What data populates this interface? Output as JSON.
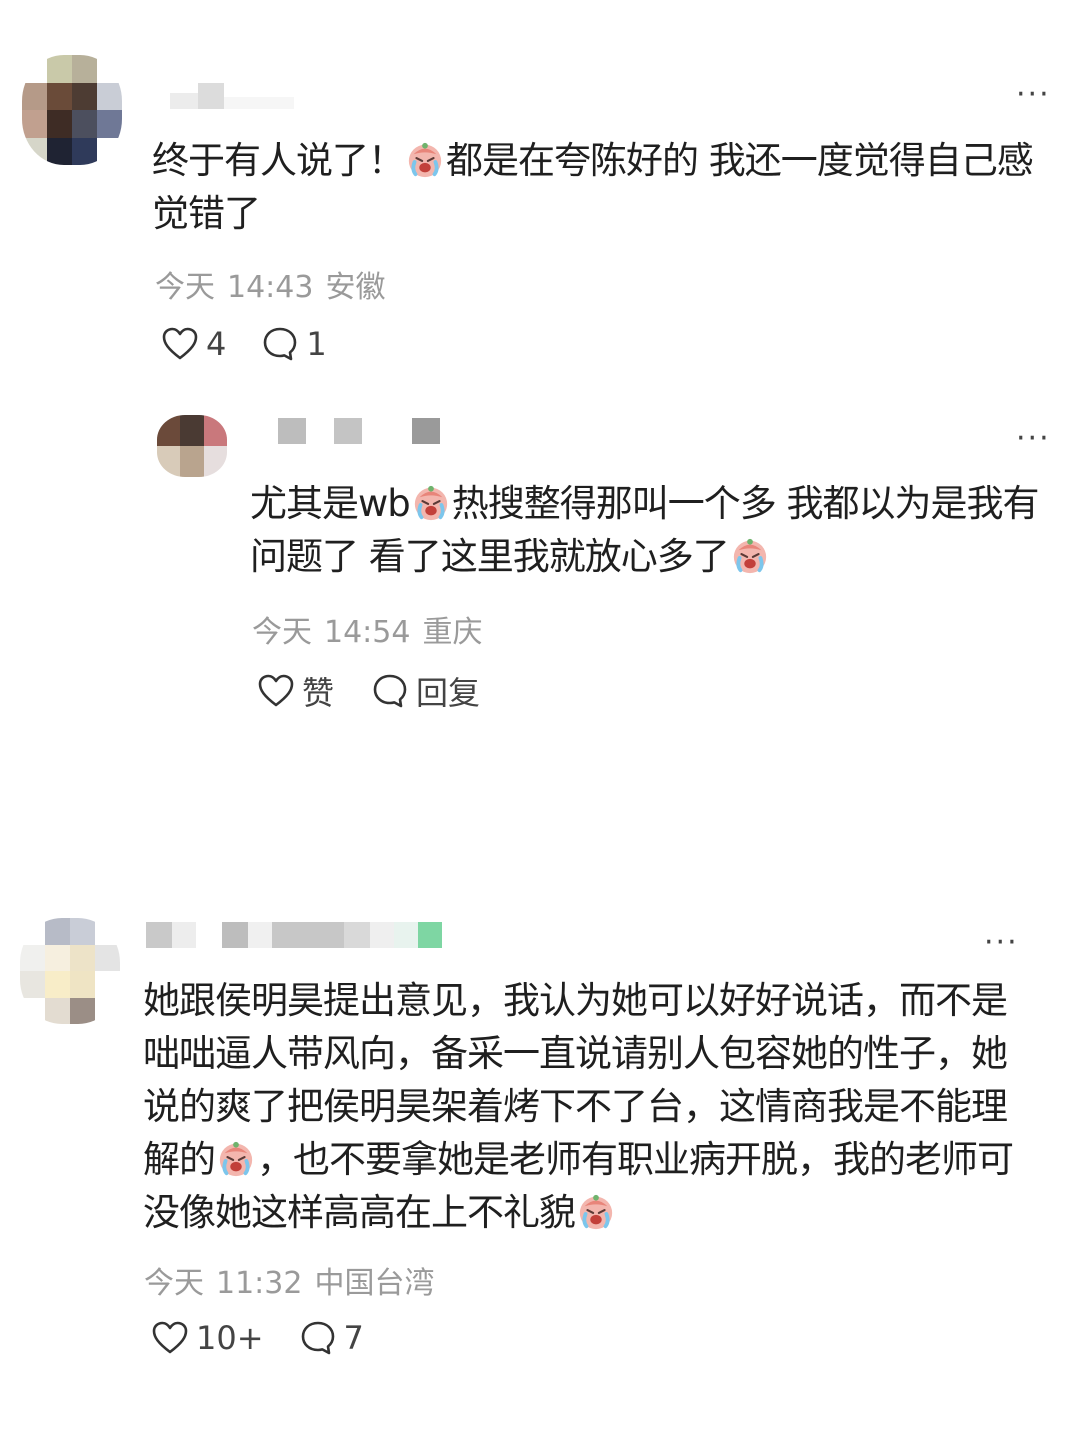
{
  "comments": [
    {
      "text_before_emoji": "终于有人说了！",
      "text_after_emoji": "都是在夸陈好的 我还一度觉得自己感觉错了",
      "date": "今天",
      "time": "14:43",
      "location": "安徽",
      "likes": "4",
      "replies": "1",
      "more": "···"
    },
    {
      "text_part1": "尤其是wb",
      "text_part2": "热搜整得那叫一个多 我都以为是我有问题了 看了这里我就放心多了",
      "date": "今天",
      "time": "14:54",
      "location": "重庆",
      "like_label": "赞",
      "reply_label": "回复",
      "more": "···"
    },
    {
      "text_part1": "她跟侯明昊提出意见，我认为她可以好好说话，而不是咄咄逼人带风向，备采一直说请别人包容她的性子，她说的爽了把侯明昊架着烤下不了台，这情商我是不能理解的",
      "text_part2": "，也不要拿她是老师有职业病开脱，我的老师可没像她这样高高在上不礼貌",
      "date": "今天",
      "time": "11:32",
      "location": "中国台湾",
      "likes": "10+",
      "replies": "7",
      "more": "···"
    }
  ],
  "icons": {
    "like": "heart-outline-icon",
    "reply": "speech-bubble-icon",
    "emoji": "crying-face-emoji"
  },
  "colors": {
    "text": "#1f1f1f",
    "meta": "#9a9a9a"
  }
}
